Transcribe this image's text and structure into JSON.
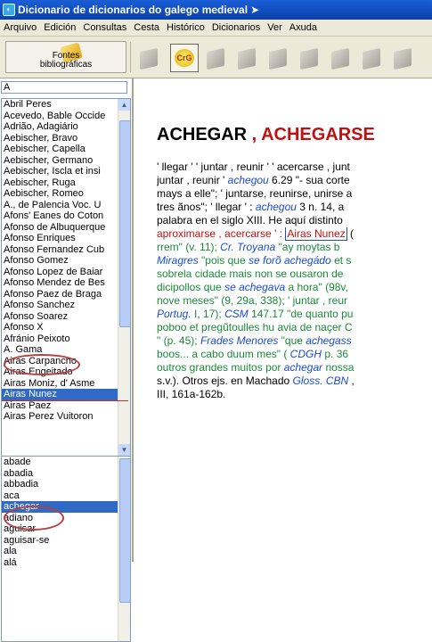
{
  "window": {
    "title": "Dicionario de dicionarios do galego medieval",
    "icon": "app-icon",
    "cursor": "mouse-cursor-icon"
  },
  "menu": [
    "Arquivo",
    "Edición",
    "Consultas",
    "Cesta",
    "Histórico",
    "Dicionarios",
    "Ver",
    "Axuda"
  ],
  "toolbar": {
    "fontes_line1": "Fontes",
    "fontes_line2": "bibliográficas",
    "crg_label": "CrG"
  },
  "search": {
    "value": "A"
  },
  "authors": [
    "Abril Peres",
    "Acevedo, Bable Occide",
    "Adrião, Adagiário",
    "Aebischer, Bravo",
    "Aebischer, Capella",
    "Aebischer, Germano",
    "Aebischer, Iscla et insi",
    "Aebischer, Ruga",
    "Aebischer, Romeo",
    "A., de Palencia Voc. U",
    "Afons' Eanes do Coton",
    "Afonso de Albuquerque",
    "Afonso Enriques",
    "Afonso Fernandez Cub",
    "Afonso Gomez",
    "Afonso Lopez de Baiar",
    "Afonso Mendez de Bes",
    "Afonso Paez de Braga",
    "Afonso Sanchez",
    "Afonso Soarez",
    "Afonso X",
    "Afránio Peixoto",
    "A. Gama",
    "Airas Carpancho",
    "Airas Engeitado",
    "Airas Moniz, d' Asme",
    "Airas Nunez",
    "Airas Paez",
    "Airas Perez Vuitoron"
  ],
  "authors_selected": 26,
  "words": [
    "abade",
    "abadia",
    "abbadia",
    "aca",
    "achegar",
    "adiano",
    "aguisar",
    "aguisar-se",
    "ala",
    "alá"
  ],
  "words_selected": 4,
  "entry": {
    "lemma1": "ACHEGAR",
    "separator": " , ",
    "lemma2": "ACHEGARSE",
    "lines": [
      [
        [
          "k",
          "' llegar ' ' juntar , reunir ' ' acercarse , junt"
        ]
      ],
      [
        [
          "k",
          "juntar , reunir ' "
        ],
        [
          "i",
          "achegou"
        ],
        [
          "k",
          " 6.29 \"- sua corte"
        ]
      ],
      [
        [
          "k",
          "mays a elle\"; ' juntarse, reunirse, unirse a"
        ]
      ],
      [
        [
          "k",
          "tres ãnos\"; ' llegar ' : "
        ],
        [
          "i",
          "achegou"
        ],
        [
          "k",
          " 3 n. 14, a"
        ]
      ],
      [
        [
          "k",
          "palabra en el siglo XIII. He aquí distinto"
        ]
      ],
      [
        [
          "r",
          "aproximarse , acercarse ' : "
        ],
        [
          "box",
          "Airas Nunez"
        ],
        [
          "k",
          " ("
        ]
      ],
      [
        [
          "g",
          "rrem\" (v. 11); "
        ],
        [
          "i",
          "Cr. Troyana"
        ],
        [
          "g",
          " \"ay moytas b"
        ]
      ],
      [
        [
          "i",
          "Miragres"
        ],
        [
          "g",
          " \"pois que "
        ],
        [
          "i",
          "se forõ achegádo"
        ],
        [
          "g",
          " et s"
        ]
      ],
      [
        [
          "g",
          "sobrela cidade mais non se ousaron de"
        ]
      ],
      [
        [
          "g",
          "dicipollos que "
        ],
        [
          "i",
          "se achegava"
        ],
        [
          "g",
          " a hora\" (98v,"
        ]
      ],
      [
        [
          "g",
          "nove meses\" (9, 29a, 338); ' juntar , reur"
        ]
      ],
      [
        [
          "i",
          "Portug."
        ],
        [
          "g",
          " I, 17); "
        ],
        [
          "i",
          "CSM"
        ],
        [
          "g",
          " 147.17 \"de quanto pu"
        ]
      ],
      [
        [
          "g",
          "poboo et pregũtoulles hu avia de naçer C"
        ]
      ],
      [
        [
          "g",
          "\" (p. 45); "
        ],
        [
          "i",
          "Frades Menores"
        ],
        [
          "g",
          " \"que "
        ],
        [
          "i",
          "achegass"
        ]
      ],
      [
        [
          "g",
          "boos... a cabo duum mes\" ( "
        ],
        [
          "i",
          "CDGH"
        ],
        [
          "g",
          " p. 36"
        ]
      ],
      [
        [
          "g",
          "outros grandes muitos por "
        ],
        [
          "i",
          "achegar"
        ],
        [
          "g",
          " nossa"
        ]
      ],
      [
        [
          "k",
          "s.v.). Otros ejs. en Machado "
        ],
        [
          "i",
          "Gloss. CBN"
        ],
        [
          "k",
          " ,"
        ]
      ],
      [
        [
          "k",
          "III, 161a-162b."
        ]
      ]
    ]
  }
}
